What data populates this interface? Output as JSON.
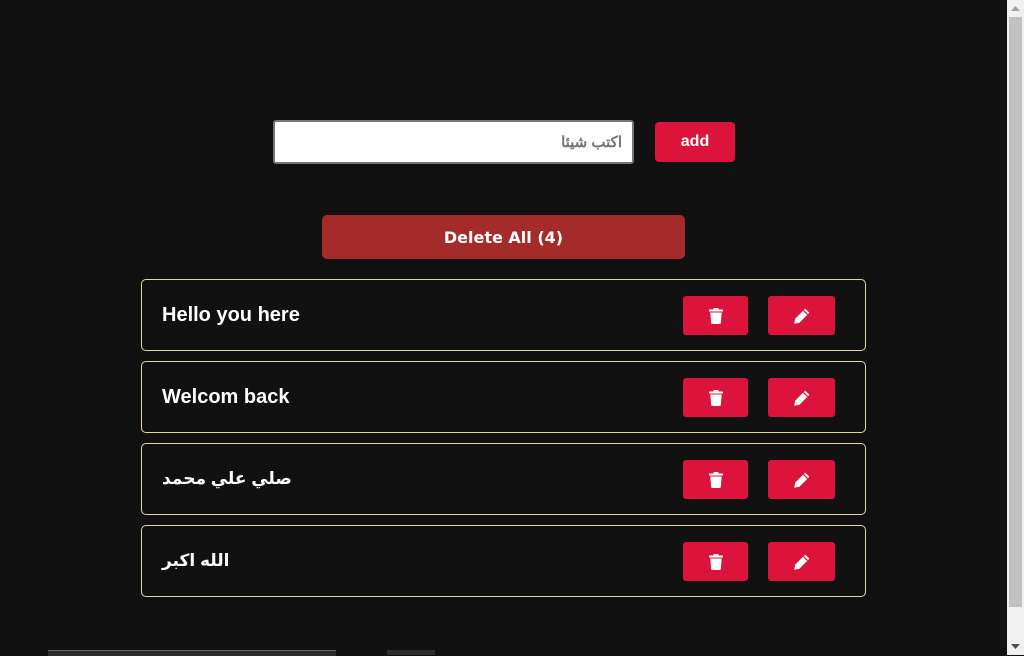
{
  "input": {
    "placeholder": "اكتب شيئا",
    "value": ""
  },
  "add_button": {
    "label": "add"
  },
  "delete_all": {
    "label": "Delete All",
    "count": "4"
  },
  "tasks": [
    {
      "text": "Hello you here"
    },
    {
      "text": "Welcom back"
    },
    {
      "text": "صلي علي محمد"
    },
    {
      "text": "الله اكبر"
    }
  ],
  "icons": {
    "delete": "trash-icon",
    "edit": "pencil-icon"
  },
  "colors": {
    "background": "#111111",
    "accent": "#dc143c",
    "delete_all": "#a52a2a",
    "task_border": "#e8d7a6",
    "text": "#ffffff"
  }
}
